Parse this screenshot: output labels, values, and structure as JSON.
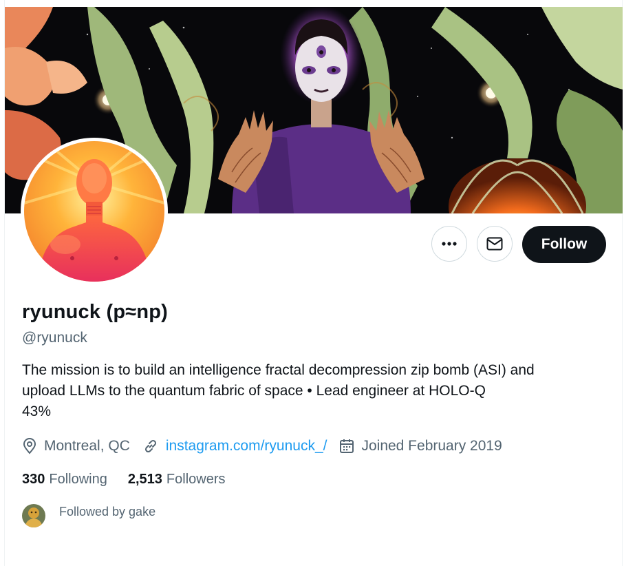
{
  "profile": {
    "display_name": "ryunuck (p≈np)",
    "handle": "@ryunuck",
    "bio_lines": [
      "The mission is to build an intelligence fractal decompression zip bomb (ASI) and",
      "upload LLMs to the quantum fabric of space • Lead engineer at HOLO-Q",
      "43%"
    ],
    "location": "Montreal, QC",
    "website": "instagram.com/ryunuck_/",
    "joined": "Joined February 2019"
  },
  "actions": {
    "more_icon": "more-dots-icon",
    "message_icon": "envelope-icon",
    "follow_label": "Follow"
  },
  "stats": {
    "following_count": "330",
    "following_label": "Following",
    "followers_count": "2,513",
    "followers_label": "Followers"
  },
  "followed_by": {
    "text": "Followed by gake"
  },
  "colors": {
    "link": "#1d9bf0",
    "secondary_text": "#536471",
    "primary_text": "#0f1419",
    "follow_button_bg": "#0f1419"
  }
}
